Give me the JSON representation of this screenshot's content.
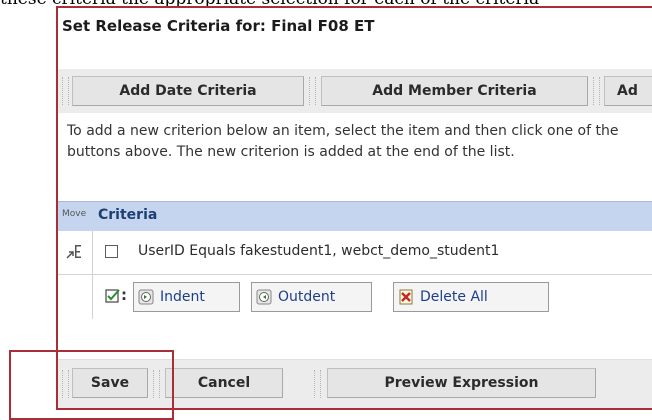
{
  "background_text": "these criteria the appropriate selection for each of the criteria",
  "page_title": "Set Release Criteria for: Final F08 ET",
  "toolbar": {
    "add_date": "Add Date Criteria",
    "add_member": "Add Member Criteria",
    "add_truncated": "Ad"
  },
  "instructions": "To add a new criterion below an item, select the item and then click one of the buttons above. The new criterion is added at the end of the list.",
  "table": {
    "move_header": "Move",
    "criteria_header": "Criteria",
    "rows": [
      {
        "text": "UserID Equals fakestudent1, webct_demo_student1"
      }
    ],
    "actions": {
      "indent": "Indent",
      "outdent": "Outdent",
      "delete_all": "Delete All"
    }
  },
  "bottom": {
    "save": "Save",
    "cancel": "Cancel",
    "preview": "Preview Expression"
  },
  "colors": {
    "accent_frame": "#a82f38",
    "header_bg": "#c6d5ef",
    "link_blue": "#1b3f8b"
  }
}
